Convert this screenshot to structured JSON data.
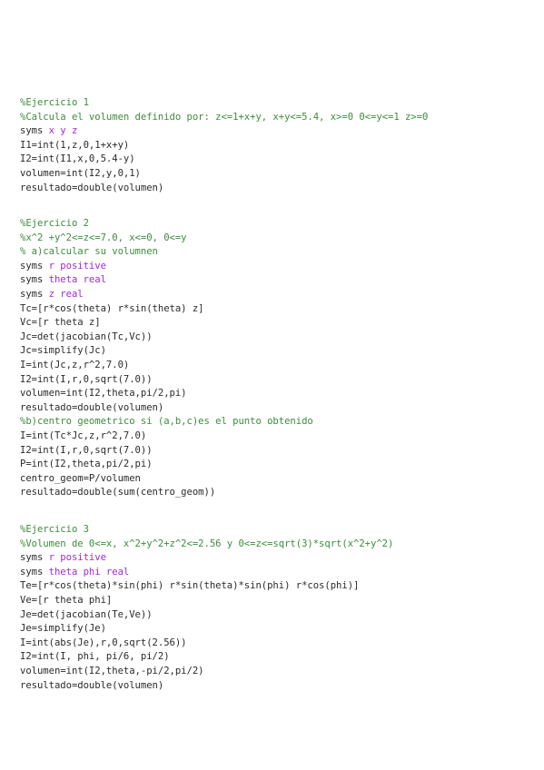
{
  "blocks": [
    {
      "lines": [
        [
          {
            "t": "%Ejercicio 1",
            "c": "comment"
          }
        ],
        [
          {
            "t": "%Calcula el volumen definido por: z<=1+x+y, x+y<=5.4, x>=0 0<=y<=1 z>=0",
            "c": "comment"
          }
        ],
        [
          {
            "t": "syms "
          },
          {
            "t": "x y z",
            "c": "purple"
          }
        ],
        [
          {
            "t": "I1=int(1,z,0,1+x+y)"
          }
        ],
        [
          {
            "t": "I2=int(I1,x,0,5.4-y)"
          }
        ],
        [
          {
            "t": "volumen=int(I2,y,0,1)"
          }
        ],
        [
          {
            "t": "resultado=double(volumen)"
          }
        ]
      ]
    },
    {
      "lines": [
        [
          {
            "t": "%Ejercicio 2",
            "c": "comment"
          }
        ],
        [
          {
            "t": "%x^2 +y^2<=z<=7.0, x<=0, 0<=y",
            "c": "comment"
          }
        ],
        [
          {
            "t": "% a)calcular su volumnen",
            "c": "comment"
          }
        ],
        [
          {
            "t": "syms "
          },
          {
            "t": "r positive",
            "c": "purple"
          }
        ],
        [
          {
            "t": "syms "
          },
          {
            "t": "theta real",
            "c": "purple"
          }
        ],
        [
          {
            "t": "syms "
          },
          {
            "t": "z real",
            "c": "purple"
          }
        ],
        [
          {
            "t": "Tc=[r*cos(theta) r*sin(theta) z]"
          }
        ],
        [
          {
            "t": "Vc=[r theta z]"
          }
        ],
        [
          {
            "t": "Jc=det(jacobian(Tc,Vc))"
          }
        ],
        [
          {
            "t": "Jc=simplify(Jc)"
          }
        ],
        [
          {
            "t": "I=int(Jc,z,r^2,7.0)"
          }
        ],
        [
          {
            "t": "I2=int(I,r,0,sqrt(7.0))"
          }
        ],
        [
          {
            "t": "volumen=int(I2,theta,pi/2,pi)"
          }
        ],
        [
          {
            "t": "resultado=double(volumen)"
          }
        ],
        [
          {
            "t": "%b)centro geometrico si (a,b,c)es el punto obtenido",
            "c": "comment"
          }
        ],
        [
          {
            "t": "I=int(Tc*Jc,z,r^2,7.0)"
          }
        ],
        [
          {
            "t": "I2=int(I,r,0,sqrt(7.0))"
          }
        ],
        [
          {
            "t": "P=int(I2,theta,pi/2,pi)"
          }
        ],
        [
          {
            "t": "centro_geom=P/volumen"
          }
        ],
        [
          {
            "t": "resultado=double(sum(centro_geom))"
          }
        ]
      ]
    },
    {
      "lines": [
        [
          {
            "t": "%Ejercicio 3",
            "c": "comment"
          }
        ],
        [
          {
            "t": "%Volumen de 0<=x, x^2+y^2+z^2<=2.56 y 0<=z<=sqrt(3)*sqrt(x^2+y^2)",
            "c": "comment"
          }
        ],
        [
          {
            "t": "syms "
          },
          {
            "t": "r positive",
            "c": "purple"
          }
        ],
        [
          {
            "t": "syms "
          },
          {
            "t": "theta phi real",
            "c": "purple"
          }
        ],
        [
          {
            "t": "Te=[r*cos(theta)*sin(phi) r*sin(theta)*sin(phi) r*cos(phi)]"
          }
        ],
        [
          {
            "t": "Ve=[r theta phi]"
          }
        ],
        [
          {
            "t": "Je=det(jacobian(Te,Ve))"
          }
        ],
        [
          {
            "t": "Je=simplify(Je)"
          }
        ],
        [
          {
            "t": "I=int(abs(Je),r,0,sqrt(2.56))"
          }
        ],
        [
          {
            "t": "I2=int(I, phi, pi/6, pi/2)"
          }
        ],
        [
          {
            "t": "volumen=int(I2,theta,-pi/2,pi/2)"
          }
        ],
        [
          {
            "t": "resultado=double(volumen)"
          }
        ]
      ]
    }
  ]
}
